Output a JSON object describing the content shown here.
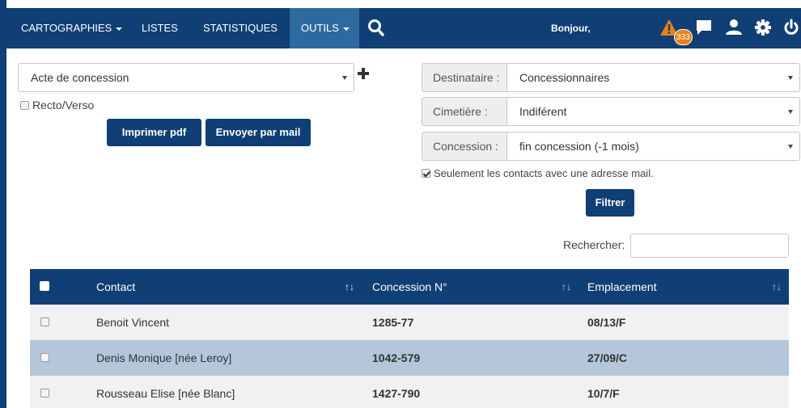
{
  "navbar": {
    "menu": [
      {
        "label": "CARTOGRAPHIES",
        "dropdown": true
      },
      {
        "label": "LISTES",
        "dropdown": false
      },
      {
        "label": "STATISTIQUES",
        "dropdown": false
      },
      {
        "label": "OUTILS",
        "dropdown": true,
        "active": true
      }
    ],
    "greeting": "Bonjour,",
    "alert_count": "333",
    "icons": [
      "search-icon",
      "warning-icon",
      "chat-icon",
      "user-icon",
      "gear-icon",
      "power-icon"
    ]
  },
  "document": {
    "type_select": "Acte de concession",
    "recto_verso_label": "Recto/Verso",
    "recto_verso_checked": false,
    "print_button": "Imprimer pdf",
    "mail_button": "Envoyer par mail"
  },
  "filters": {
    "destinataire": {
      "label": "Destinataire :",
      "value": "Concessionnaires"
    },
    "cimetiere": {
      "label": "Cimetière :",
      "value": "Indiférent"
    },
    "concession": {
      "label": "Concession :",
      "value": "fin concession (-1 mois)"
    },
    "mail_only_label": "Seulement les contacts avec une adresse mail.",
    "mail_only_checked": true,
    "filter_button": "Filtrer"
  },
  "search": {
    "label": "Rechercher:",
    "value": ""
  },
  "table": {
    "columns": [
      "Contact",
      "Concession N°",
      "Emplacement"
    ],
    "sort_icon": "↑↓",
    "rows": [
      {
        "contact": "Benoit Vincent",
        "concession": "1285-77",
        "emplacement": "08/13/F",
        "selected": false
      },
      {
        "contact": "Denis Monique [née Leroy]",
        "concession": "1042-579",
        "emplacement": "27/09/C",
        "selected": true
      },
      {
        "contact": "Rousseau Elise [née Blanc]",
        "concession": "1427-790",
        "emplacement": "10/7/F",
        "selected": false
      }
    ]
  },
  "colors": {
    "primary": "#0f3f74",
    "active_nav": "#2c6aa0",
    "selected_row": "#b3c6da",
    "alert": "#e7821d"
  }
}
